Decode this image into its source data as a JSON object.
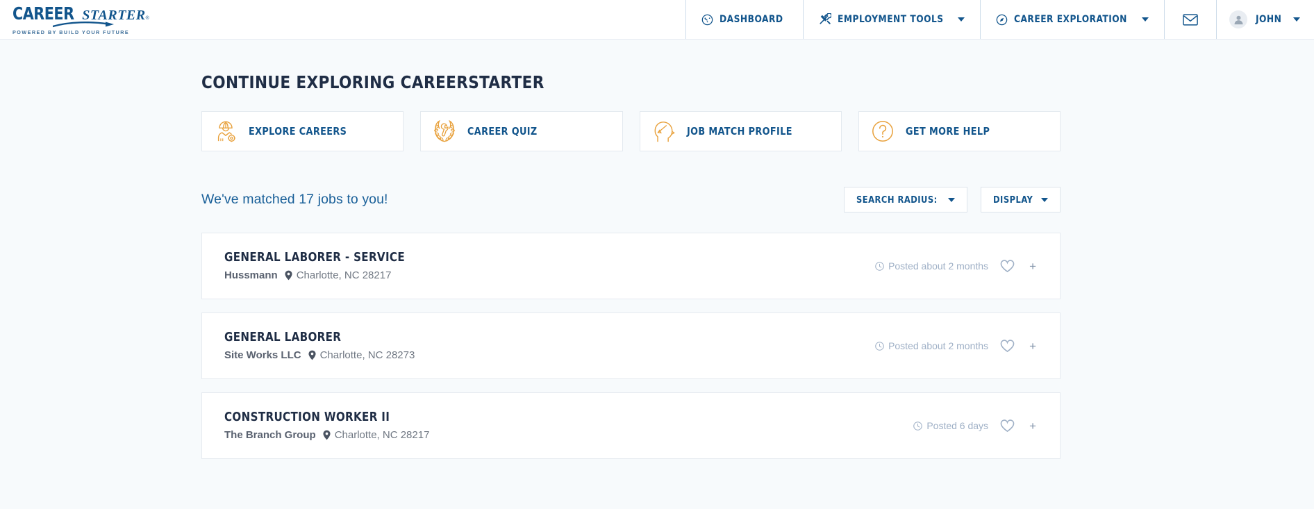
{
  "header": {
    "logo": {
      "word1": "CAREER",
      "word2": "STARTER",
      "registered": "®",
      "tagline": "POWERED BY BUILD YOUR FUTURE"
    },
    "nav": [
      {
        "label": "DASHBOARD",
        "icon": "gauge-icon",
        "has_caret": false,
        "name": "dashboard"
      },
      {
        "label": "EMPLOYMENT TOOLS",
        "icon": "tools-icon",
        "has_caret": true,
        "name": "employment-tools"
      },
      {
        "label": "CAREER EXPLORATION",
        "icon": "compass-icon",
        "has_caret": true,
        "name": "career-exploration"
      }
    ],
    "mail_icon": "envelope-icon",
    "user": {
      "name": "JOHN",
      "avatar_icon": "user-avatar-icon"
    }
  },
  "main": {
    "page_title": "CONTINUE EXPLORING CAREERSTARTER",
    "action_cards": [
      {
        "label": "EXPLORE CAREERS",
        "icon": "construction-worker-icon",
        "name": "explore-careers"
      },
      {
        "label": "CAREER QUIZ",
        "icon": "laurel-wrench-icon",
        "name": "career-quiz"
      },
      {
        "label": "JOB MATCH PROFILE",
        "icon": "head-profile-icon",
        "name": "job-match-profile"
      },
      {
        "label": "GET MORE HELP",
        "icon": "question-circle-icon",
        "name": "get-more-help"
      }
    ],
    "match_text": "We've matched 17 jobs to you!",
    "match_count": 17,
    "filters": [
      {
        "label": "SEARCH RADIUS:",
        "name": "search-radius"
      },
      {
        "label": "DISPLAY",
        "name": "display"
      }
    ],
    "jobs": [
      {
        "title": "GENERAL LABORER - SERVICE",
        "company": "Hussmann",
        "location": "Charlotte, NC 28217",
        "posted": "Posted about 2 months",
        "save_icon": "heart-icon",
        "add_icon": "plus-icon"
      },
      {
        "title": "GENERAL LABORER",
        "company": "Site Works LLC",
        "location": "Charlotte, NC 28273",
        "posted": "Posted about 2 months",
        "save_icon": "heart-icon",
        "add_icon": "plus-icon"
      },
      {
        "title": "CONSTRUCTION WORKER II",
        "company": "The Branch Group",
        "location": "Charlotte, NC 28217",
        "posted": "Posted 6 days",
        "save_icon": "heart-icon",
        "add_icon": "plus-icon"
      }
    ]
  },
  "colors": {
    "brand_blue": "#12558c",
    "accent_orange": "#e8a13c",
    "page_bg": "#f7fafc",
    "title_navy": "#1f2d45",
    "muted_blue": "#9fb0c6"
  }
}
